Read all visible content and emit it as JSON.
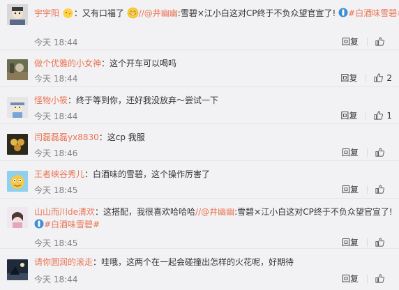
{
  "comments": [
    {
      "user": "宇宇阳",
      "sep": "：",
      "text_before": "又有口福了",
      "link1": "//@井幽幽",
      "text_mid": ":雪碧×江小白这对CP终于不负众望官宣了!",
      "topic": "#白酒味雪碧#",
      "time": "今天 18:44",
      "reply": "回复",
      "likes": ""
    },
    {
      "user": "做个优雅的小女神",
      "sep": "：",
      "text": "这个开车可以喝吗",
      "time": "今天 18:44",
      "reply": "回复",
      "likes": "2"
    },
    {
      "user": "怪物小筱",
      "sep": "：",
      "text": "终于等到你，还好我没放弃～尝试一下",
      "time": "今天 18:44",
      "reply": "回复",
      "likes": "1"
    },
    {
      "user": "闫磊磊磊yx8830",
      "sep": "：",
      "text": "这cp 我服",
      "time": "今天 18:46",
      "reply": "回复",
      "likes": ""
    },
    {
      "user": "王者峡谷秀儿",
      "sep": "：",
      "text": "白酒味的雪碧，这个操作厉害了",
      "time": "今天 18:45",
      "reply": "回复",
      "likes": ""
    },
    {
      "user": "山山而川de清欢",
      "sep": "：",
      "text_before": "这搭配，我很喜欢哈哈哈",
      "link1": "//@井幽幽",
      "text_mid": ":雪碧×江小白这对CP终于不负众望官宣了!",
      "topic": "#白酒味雪碧#",
      "time": "今天 18:45",
      "reply": "回复",
      "likes": ""
    },
    {
      "user": "请你圆润的滚走",
      "sep": "：",
      "text": "哇哦，这两个在一起会碰撞出怎样的火花呢，好期待",
      "time": "今天 18:44",
      "reply": "回复",
      "likes": ""
    }
  ],
  "colors": {
    "username": "#eb7350",
    "time": "#808080",
    "background": "#f2f2f5"
  }
}
